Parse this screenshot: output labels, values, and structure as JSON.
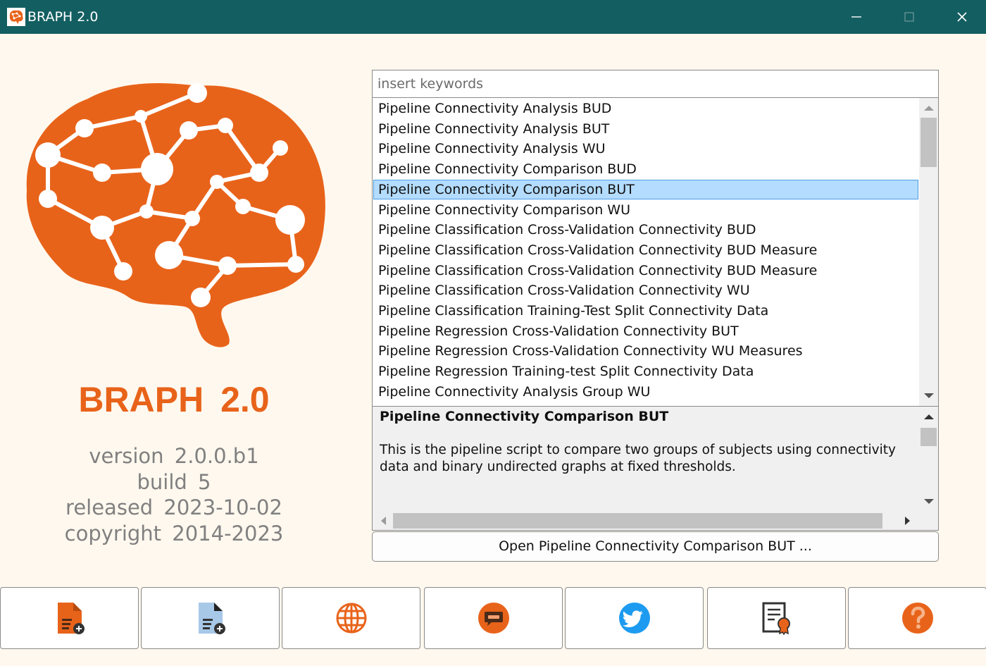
{
  "window": {
    "title": "BRAPH 2.0",
    "app_icon": "brain-icon",
    "controls": [
      "minimize-icon",
      "maximize-icon",
      "close-icon"
    ]
  },
  "about": {
    "app_name": "BRAPH 2.0",
    "version": "version  2.0.0.b1",
    "build": "build  5",
    "released": "released  2023-10-02",
    "copyright": "copyright  2014-2023",
    "brand_color": "#e8631a"
  },
  "search": {
    "placeholder": "insert keywords",
    "value": ""
  },
  "pipelines": {
    "selected_index": 4,
    "items": [
      {
        "label": "Pipeline Connectivity Analysis BUD"
      },
      {
        "label": "Pipeline Connectivity Analysis BUT"
      },
      {
        "label": "Pipeline Connectivity Analysis WU"
      },
      {
        "label": "Pipeline Connectivity Comparison BUD"
      },
      {
        "label": "Pipeline Connectivity Comparison BUT"
      },
      {
        "label": "Pipeline Connectivity Comparison WU"
      },
      {
        "label": "Pipeline Classification Cross-Validation Connectivity BUD"
      },
      {
        "label": "Pipeline Classification Cross-Validation Connectivity BUD Measure"
      },
      {
        "label": "Pipeline Classification Cross-Validation Connectivity BUD Measure"
      },
      {
        "label": "Pipeline Classification Cross-Validation Connectivity WU"
      },
      {
        "label": "Pipeline Classification Training-Test Split Connectivity Data"
      },
      {
        "label": "Pipeline Regression Cross-Validation Connectivity BUT"
      },
      {
        "label": "Pipeline Regression Cross-Validation Connectivity WU Measures"
      },
      {
        "label": "Pipeline Regression Training-test Split Connectivity Data"
      },
      {
        "label": "Pipeline Connectivity Analysis Group WU"
      }
    ]
  },
  "description": {
    "title": "Pipeline Connectivity Comparison BUT",
    "text": "This is the pipeline script to compare two groups of subjects using connectivity data and binary undirected graphs at fixed thresholds."
  },
  "open_button": {
    "label": "Open Pipeline Connectivity Comparison BUT ..."
  },
  "toolbar": {
    "buttons": [
      {
        "icon": "new-script-icon",
        "color": "#e8631a"
      },
      {
        "icon": "open-script-icon",
        "color": "#a8c8e8"
      },
      {
        "icon": "website-globe-icon",
        "color": "#e8631a"
      },
      {
        "icon": "forum-chat-icon",
        "color": "#e8631a"
      },
      {
        "icon": "twitter-icon",
        "color": "#1d9bf0"
      },
      {
        "icon": "license-certificate-icon",
        "color": "#e8631a"
      },
      {
        "icon": "help-question-icon",
        "color": "#e8631a"
      }
    ]
  }
}
